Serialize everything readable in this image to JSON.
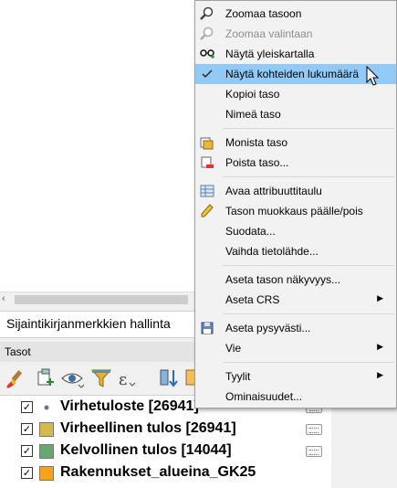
{
  "bookmarks_panel": {
    "title": "Sijaintikirjanmerkkien hallinta"
  },
  "layers_panel": {
    "title": "Tasot",
    "layers": [
      {
        "name": "Virhetuloste [26941]",
        "checked": true,
        "color": "#7f8fa6"
      },
      {
        "name": "Virheellinen tulos [26941]",
        "checked": true,
        "color": "#d4b84a"
      },
      {
        "name": "Kelvollinen tulos [14044]",
        "checked": true,
        "color": "#6aa66f"
      },
      {
        "name": "Rakennukset_alueina_GK25",
        "checked": true,
        "color": "#f5a21c"
      }
    ]
  },
  "context_menu": {
    "items": [
      {
        "label": "Zoomaa tasoon",
        "icon": "zoom-icon"
      },
      {
        "label": "Zoomaa valintaan",
        "icon": "zoom-selection-icon",
        "disabled": true
      },
      {
        "label": "Näytä yleiskartalla",
        "icon": "glasses-icon"
      },
      {
        "label": "Näytä kohteiden lukumäärä",
        "icon": "check-icon",
        "checked": true
      },
      {
        "label": "Kopioi taso"
      },
      {
        "label": "Nimeä taso"
      },
      {
        "label": "Monista taso",
        "icon": "duplicate-icon"
      },
      {
        "label": "Poista taso...",
        "icon": "remove-layer-icon"
      },
      {
        "label": "Avaa attribuuttitaulu",
        "icon": "table-icon"
      },
      {
        "label": "Tason muokkaus päälle/pois",
        "icon": "pencil-icon"
      },
      {
        "label": "Suodata..."
      },
      {
        "label": "Vaihda tietolähde..."
      },
      {
        "label": "Aseta tason näkyvyys..."
      },
      {
        "label": "Aseta CRS",
        "submenu": true
      },
      {
        "label": "Aseta pysyvästi...",
        "icon": "save-icon"
      },
      {
        "label": "Vie",
        "submenu": true
      },
      {
        "label": "Tyylit",
        "submenu": true
      },
      {
        "label": "Ominaisuudet..."
      }
    ]
  },
  "colors": {
    "highlight": "#91c9f7",
    "menu_bg": "#f2f2f2"
  }
}
